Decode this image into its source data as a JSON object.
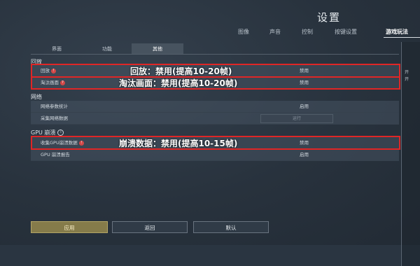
{
  "header": {
    "title": "设置"
  },
  "top_tabs": [
    "图像",
    "声音",
    "控制",
    "按键设置",
    "游戏玩法"
  ],
  "right_edge": [
    "开",
    "开"
  ],
  "sub_tabs": [
    "界面",
    "功能",
    "其他"
  ],
  "sections": {
    "replay": {
      "title": "回放",
      "rows": [
        {
          "label": "回放",
          "badge": "!",
          "value": "禁用"
        },
        {
          "label": "淘汰画面",
          "badge": "?",
          "value": "禁用"
        }
      ]
    },
    "network": {
      "title": "网络",
      "rows": [
        {
          "label": "网络参数统计",
          "value": "启用"
        },
        {
          "label": "采集网络数据",
          "button": "运行"
        }
      ]
    },
    "gpu": {
      "title": "GPU 崩溃",
      "info": "i",
      "rows": [
        {
          "label": "收集GPU崩溃数据",
          "badge": "!",
          "value": "禁用"
        },
        {
          "label": "GPU 崩溃报告",
          "value": "启用"
        }
      ]
    }
  },
  "annotations": {
    "replay": "回放：禁用(提高10-20帧)",
    "elimination": "淘汰画面：禁用(提高10-20帧)",
    "gpu": "崩溃数据：禁用(提高10-15帧)"
  },
  "buttons": {
    "apply": "应用",
    "back": "返回",
    "default": "默认"
  },
  "colors": {
    "annotation": "#e02626",
    "apply": "#857b4a",
    "badge": "#d24848"
  }
}
